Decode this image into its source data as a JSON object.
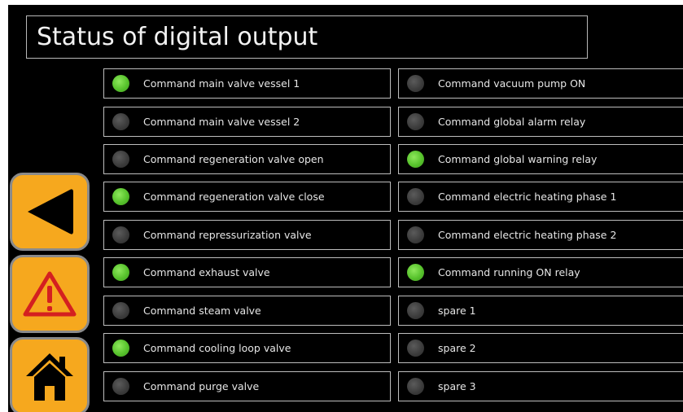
{
  "header": {
    "title": "Status of digital output"
  },
  "colors": {
    "led_on": "#57c22c",
    "led_off": "#3a3a3a",
    "button_fill": "#f6a81e",
    "background": "#000000"
  },
  "navigation": {
    "buttons": [
      {
        "icon": "back-arrow-icon"
      },
      {
        "icon": "warning-icon"
      },
      {
        "icon": "home-icon"
      }
    ]
  },
  "outputs": {
    "left": [
      {
        "label": "Command main valve vessel 1",
        "state": "on"
      },
      {
        "label": "Command main valve vessel 2",
        "state": "off"
      },
      {
        "label": "Command regeneration valve open",
        "state": "off"
      },
      {
        "label": "Command regeneration valve close",
        "state": "on"
      },
      {
        "label": "Command repressurization valve",
        "state": "off"
      },
      {
        "label": "Command exhaust valve",
        "state": "on"
      },
      {
        "label": "Command steam valve",
        "state": "off"
      },
      {
        "label": "Command cooling loop valve",
        "state": "on"
      },
      {
        "label": "Command purge valve",
        "state": "off"
      }
    ],
    "right": [
      {
        "label": "Command vacuum pump ON",
        "state": "off"
      },
      {
        "label": "Command global alarm relay",
        "state": "off"
      },
      {
        "label": "Command global warning relay",
        "state": "on"
      },
      {
        "label": "Command electric heating phase 1",
        "state": "off"
      },
      {
        "label": "Command electric heating phase 2",
        "state": "off"
      },
      {
        "label": "Command running ON relay",
        "state": "on"
      },
      {
        "label": "spare 1",
        "state": "off"
      },
      {
        "label": "spare 2",
        "state": "off"
      },
      {
        "label": "spare 3",
        "state": "off"
      }
    ]
  }
}
